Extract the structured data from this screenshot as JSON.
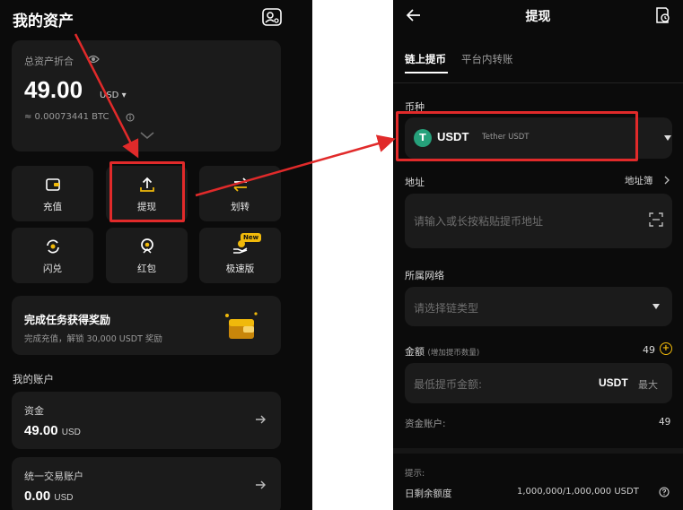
{
  "left": {
    "title": "我的资产",
    "asset_card": {
      "label": "总资产折合",
      "amount": "49.00",
      "unit": "USD",
      "btc": "≈ 0.00073441 BTC"
    },
    "actions": [
      {
        "label": "充值"
      },
      {
        "label": "提现"
      },
      {
        "label": "划转"
      },
      {
        "label": "闪兑"
      },
      {
        "label": "红包"
      },
      {
        "label": "极速版",
        "badge": "New"
      }
    ],
    "task": {
      "title": "完成任务获得奖励",
      "subtitle": "完成充值，解锁 30,000 USDT 奖励"
    },
    "accounts_heading": "我的账户",
    "accounts": [
      {
        "name": "资金",
        "amount": "49.00",
        "unit": "USD"
      },
      {
        "name": "统一交易账户",
        "amount": "0.00",
        "unit": "USD"
      }
    ]
  },
  "right": {
    "title": "提现",
    "tabs": [
      {
        "label": "链上提币",
        "active": true
      },
      {
        "label": "平台内转账",
        "active": false
      }
    ],
    "coin": {
      "label": "币种",
      "symbol": "USDT",
      "name": "Tether USDT",
      "icon_letter": "T"
    },
    "address": {
      "label": "地址",
      "book_link": "地址簿",
      "placeholder": "请输入或长按粘贴提币地址"
    },
    "network": {
      "label": "所属网络",
      "placeholder": "请选择链类型"
    },
    "amount": {
      "label": "金额",
      "hint": "(增加提币数量)",
      "count": "49",
      "placeholder": "最低提币金额:",
      "unit": "USDT",
      "max": "最大"
    },
    "funding": {
      "label": "资金账户:",
      "value": "49"
    },
    "tips": {
      "label": "提示:",
      "daily_label": "日剩余额度",
      "daily_value": "1,000,000/1,000,000 USDT"
    }
  },
  "colors": {
    "highlight": "#e12a2a",
    "card": "#1b1b1b",
    "background": "#0b0b0b",
    "accent": "#f0b90b",
    "usdt": "#26a17b"
  }
}
